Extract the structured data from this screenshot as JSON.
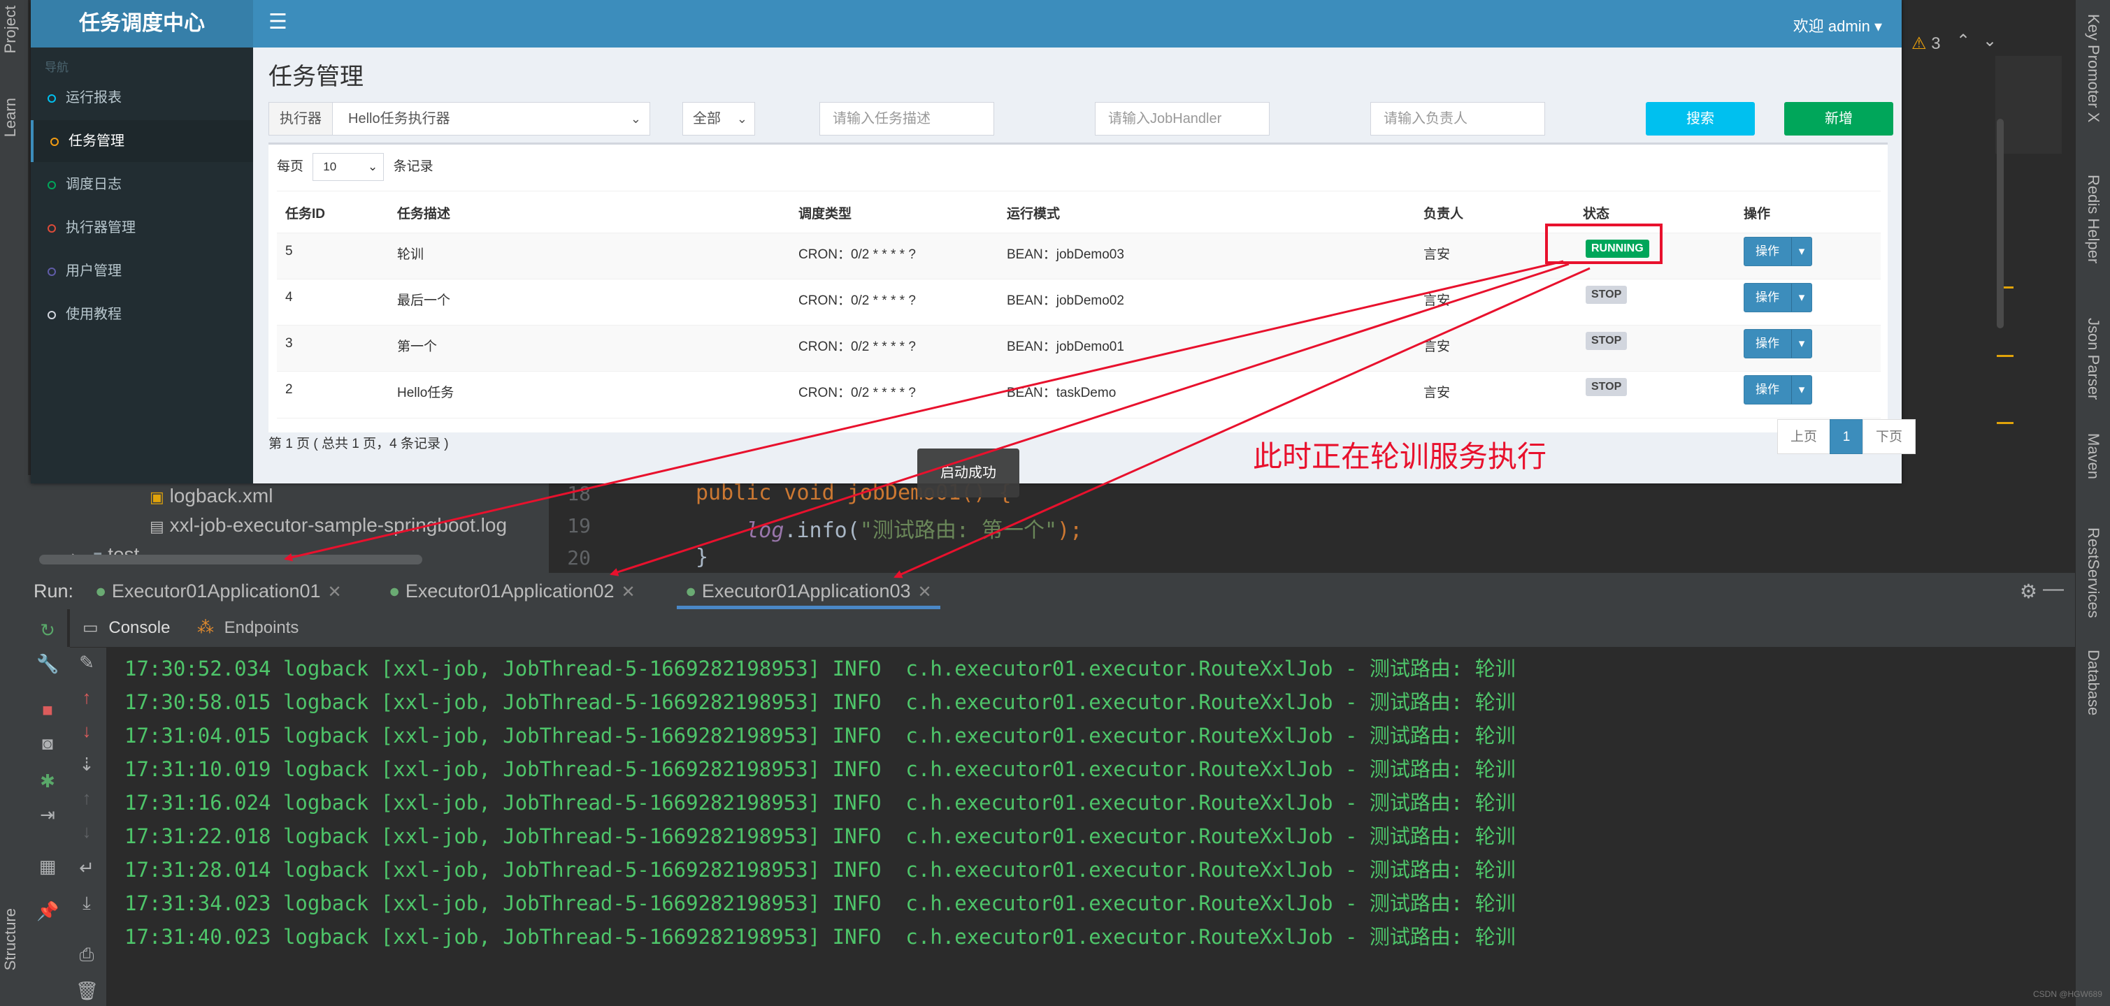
{
  "ide": {
    "left_tabs": [
      "Project",
      "Learn",
      "Structure"
    ],
    "right_tabs": [
      "Key Promoter X",
      "Redis Helper",
      "Json Parser",
      "Maven",
      "RestServices",
      "Database"
    ],
    "warnings": {
      "icon": "warning-icon",
      "count": "3"
    },
    "tree": {
      "items": [
        {
          "label": "logback.xml",
          "icon": "xml-file-icon"
        },
        {
          "label": "xxl-job-executor-sample-springboot.log",
          "icon": "file-icon"
        },
        {
          "label": "test",
          "icon": "folder-icon"
        }
      ]
    },
    "editor": {
      "lines": [
        {
          "num": "18",
          "code": "public void jobDemo01() {"
        },
        {
          "num": "19",
          "code_prefix": "    ",
          "code_method": "log",
          "code_mid": ".info(",
          "code_string": "\"测试路由: 第一个\"",
          "code_end": ");"
        },
        {
          "num": "20",
          "code": "}"
        }
      ]
    },
    "run": {
      "label": "Run:",
      "tabs": [
        {
          "label": "Executor01Application01"
        },
        {
          "label": "Executor01Application02"
        },
        {
          "label": "Executor01Application03"
        }
      ],
      "subtabs": [
        "Console",
        "Endpoints"
      ]
    },
    "console_lines": [
      "17:30:52.034 logback [xxl-job, JobThread-5-1669282198953] INFO  c.h.executor01.executor.RouteXxlJob - 测试路由: 轮训",
      "17:30:58.015 logback [xxl-job, JobThread-5-1669282198953] INFO  c.h.executor01.executor.RouteXxlJob - 测试路由: 轮训",
      "17:31:04.015 logback [xxl-job, JobThread-5-1669282198953] INFO  c.h.executor01.executor.RouteXxlJob - 测试路由: 轮训",
      "17:31:10.019 logback [xxl-job, JobThread-5-1669282198953] INFO  c.h.executor01.executor.RouteXxlJob - 测试路由: 轮训",
      "17:31:16.024 logback [xxl-job, JobThread-5-1669282198953] INFO  c.h.executor01.executor.RouteXxlJob - 测试路由: 轮训",
      "17:31:22.018 logback [xxl-job, JobThread-5-1669282198953] INFO  c.h.executor01.executor.RouteXxlJob - 测试路由: 轮训",
      "17:31:28.014 logback [xxl-job, JobThread-5-1669282198953] INFO  c.h.executor01.executor.RouteXxlJob - 测试路由: 轮训",
      "17:31:34.023 logback [xxl-job, JobThread-5-1669282198953] INFO  c.h.executor01.executor.RouteXxlJob - 测试路由: 轮训",
      "17:31:40.023 logback [xxl-job, JobThread-5-1669282198953] INFO  c.h.executor01.executor.RouteXxlJob - 测试路由: 轮训"
    ]
  },
  "web": {
    "brand": "任务调度中心",
    "welcome": "欢迎 admin ▾",
    "nav_header": "导航",
    "nav": [
      {
        "label": "运行报表",
        "color": "#00c0ef"
      },
      {
        "label": "任务管理",
        "color": "#f39c12"
      },
      {
        "label": "调度日志",
        "color": "#00a65a"
      },
      {
        "label": "执行器管理",
        "color": "#dd4b39"
      },
      {
        "label": "用户管理",
        "color": "#605ca8"
      },
      {
        "label": "使用教程",
        "color": "#d2d6de"
      }
    ],
    "page_title": "任务管理",
    "filters": {
      "executor_label": "执行器",
      "executor_value": "Hello任务执行器",
      "status_value": "全部",
      "desc_placeholder": "请输入任务描述",
      "handler_placeholder": "请输入JobHandler",
      "author_placeholder": "请输入负责人",
      "search_button": "搜索",
      "add_button": "新增"
    },
    "per_page": {
      "prefix": "每页",
      "value": "10",
      "suffix": "条记录"
    },
    "table": {
      "headers": [
        "任务ID",
        "任务描述",
        "调度类型",
        "运行模式",
        "负责人",
        "状态",
        "操作"
      ],
      "rows": [
        {
          "id": "5",
          "desc": "轮训",
          "schedule": "CRON：0/2 * * * * ?",
          "mode": "BEAN：jobDemo03",
          "author": "言安",
          "status": "RUNNING",
          "op": "操作"
        },
        {
          "id": "4",
          "desc": "最后一个",
          "schedule": "CRON：0/2 * * * * ?",
          "mode": "BEAN：jobDemo02",
          "author": "言安",
          "status": "STOP",
          "op": "操作"
        },
        {
          "id": "3",
          "desc": "第一个",
          "schedule": "CRON：0/2 * * * * ?",
          "mode": "BEAN：jobDemo01",
          "author": "言安",
          "status": "STOP",
          "op": "操作"
        },
        {
          "id": "2",
          "desc": "Hello任务",
          "schedule": "CRON：0/2 * * * * ?",
          "mode": "BEAN：taskDemo",
          "author": "言安",
          "status": "STOP",
          "op": "操作"
        }
      ]
    },
    "footer": "第 1 页 ( 总共 1 页，4 条记录 )",
    "pagination": {
      "prev": "上页",
      "current": "1",
      "next": "下页"
    },
    "toast": "启动成功"
  },
  "annotation": "此时正在轮训服务执行",
  "colors": {
    "annotation_red": "#e8112d",
    "running_green": "#00a65a",
    "stop_gray": "#d2d6de",
    "log_green": "#4ec56a"
  },
  "watermark": "CSDN @HGW689"
}
